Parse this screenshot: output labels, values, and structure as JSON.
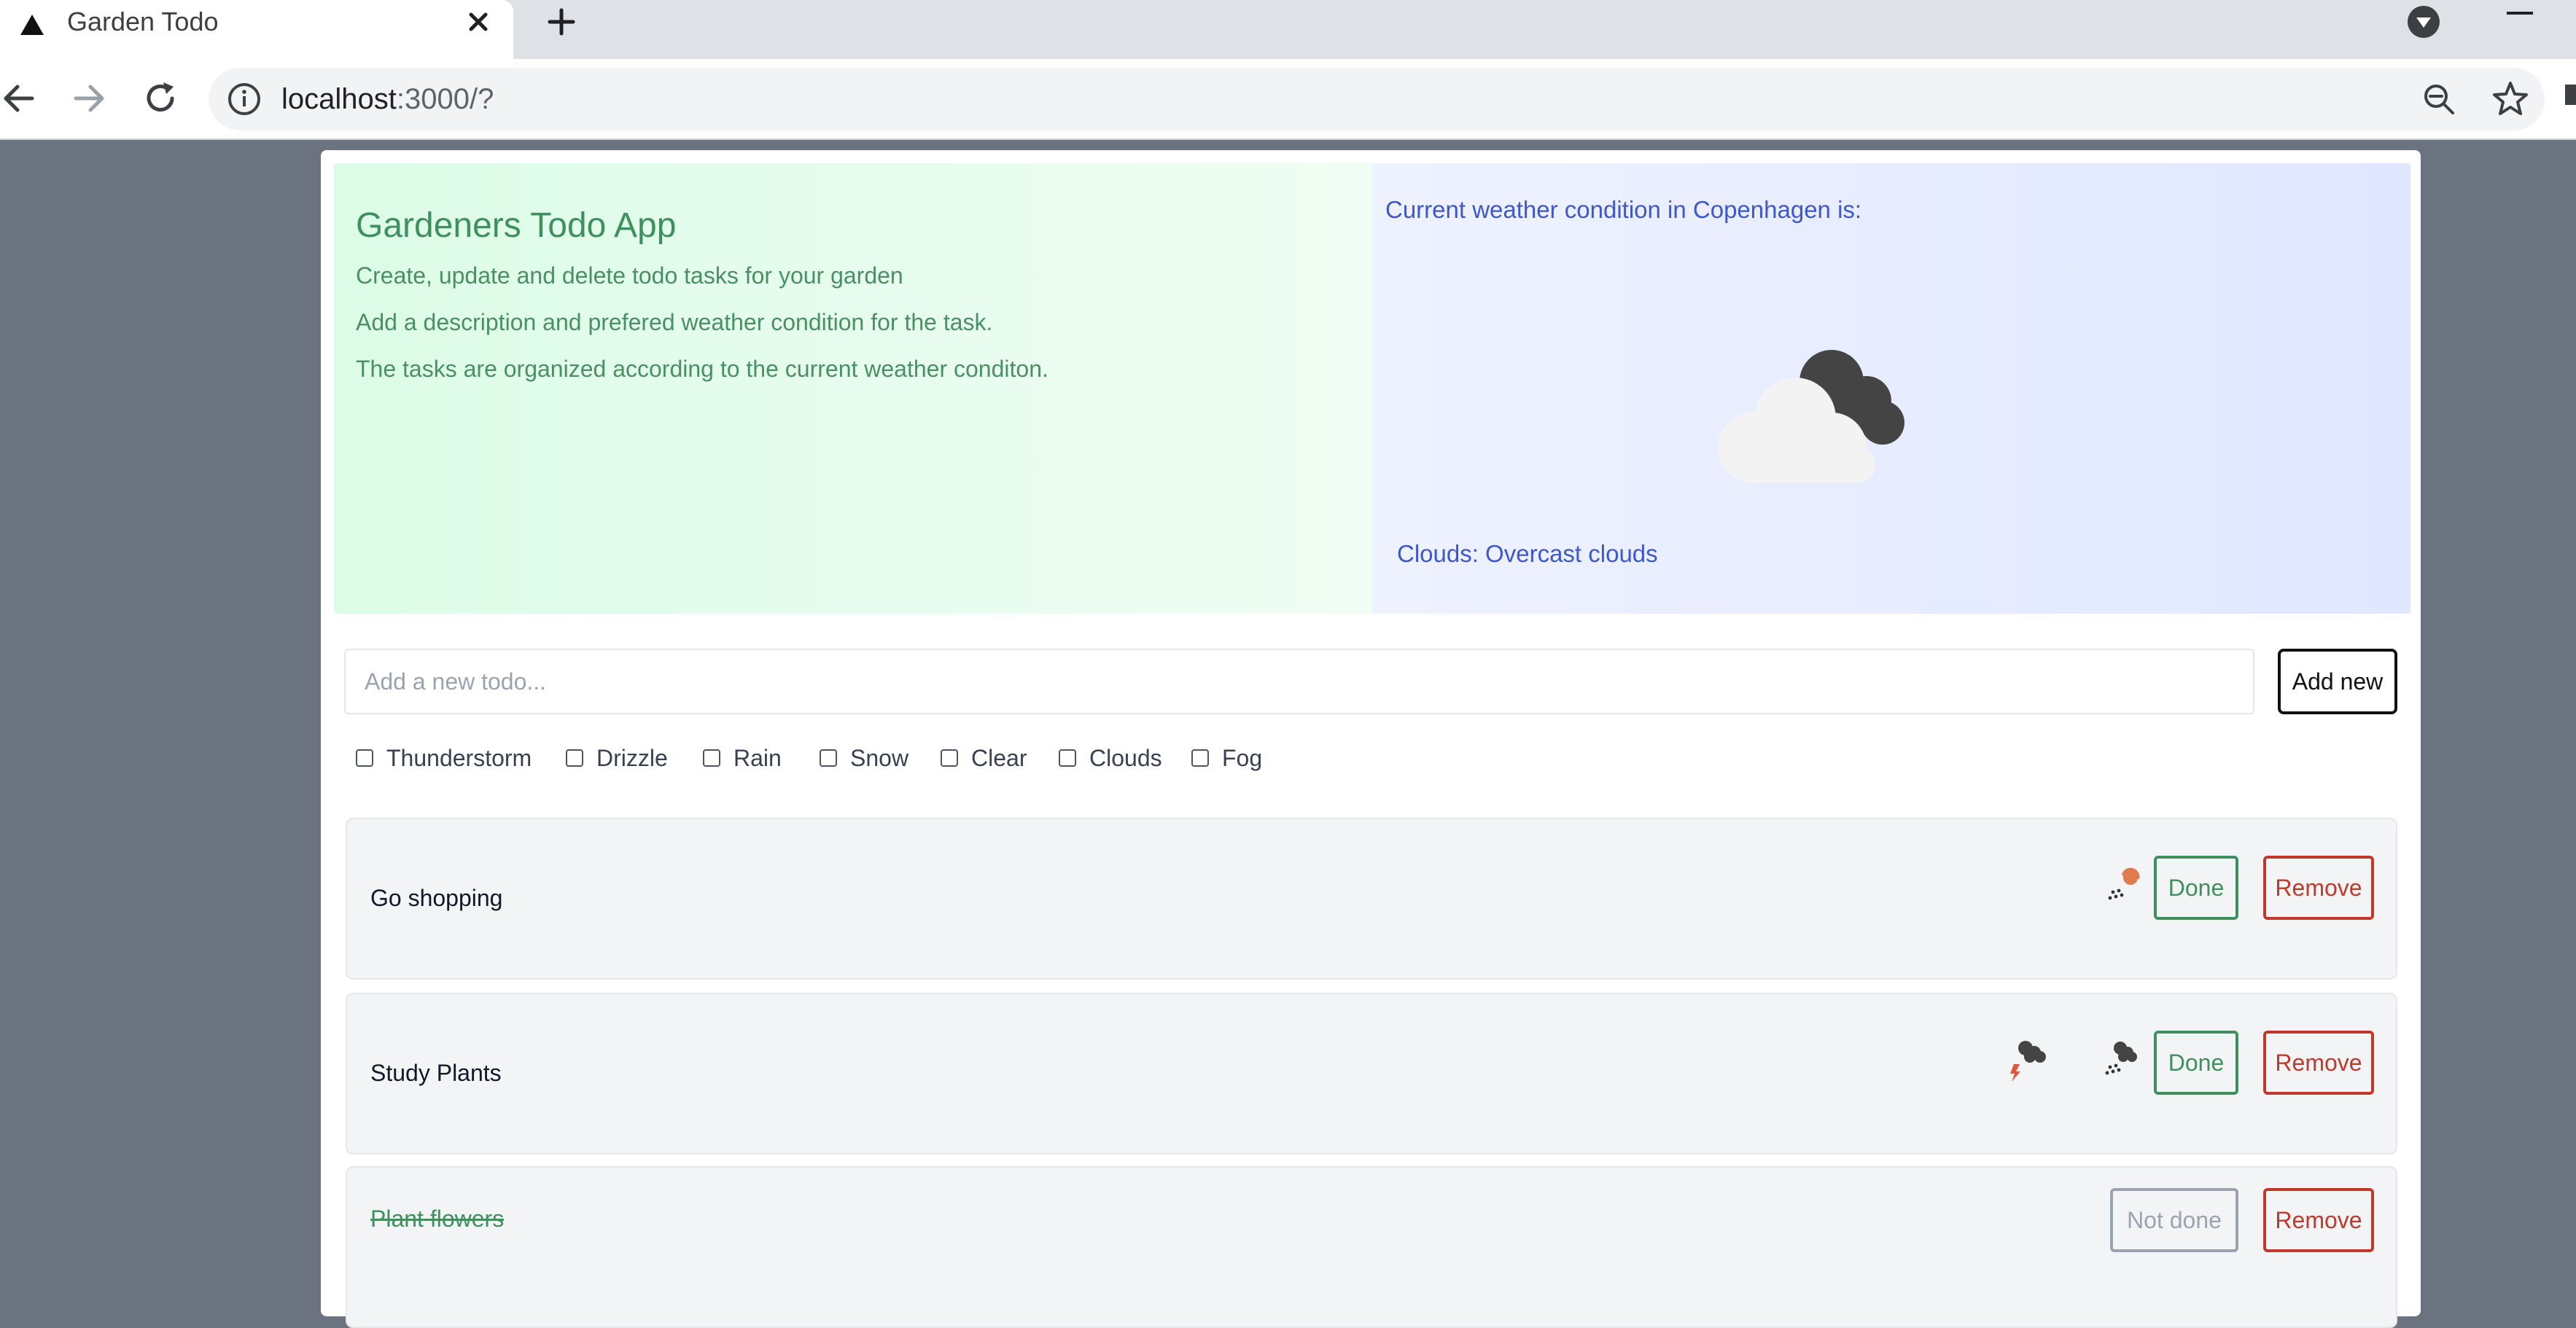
{
  "browser": {
    "tab_title": "Garden Todo",
    "url_host": "localhost",
    "url_rest": ":3000/?"
  },
  "hero": {
    "title": "Gardeners Todo App",
    "lines": [
      "Create, update and delete todo tasks for your garden",
      "Add a description and prefered weather condition for the task.",
      "The tasks are organized according to the current weather conditon."
    ]
  },
  "weather": {
    "heading": "Current weather condition in Copenhagen is:",
    "description": "Clouds: Overcast clouds",
    "icon": "overcast-clouds-icon"
  },
  "form": {
    "placeholder": "Add a new todo...",
    "add_label": "Add new",
    "conditions": [
      "Thunderstorm",
      "Drizzle",
      "Rain",
      "Snow",
      "Clear",
      "Clouds",
      "Fog"
    ]
  },
  "todos": [
    {
      "title": "Go shopping",
      "done": false,
      "action_label": "Done",
      "remove_label": "Remove",
      "weather_icons": [
        "drizzle-sun-icon"
      ]
    },
    {
      "title": "Study Plants",
      "done": false,
      "action_label": "Done",
      "remove_label": "Remove",
      "weather_icons": [
        "thunderstorm-icon",
        "drizzle-icon"
      ]
    },
    {
      "title": "Plant flowers",
      "done": true,
      "action_label": "Not done",
      "remove_label": "Remove",
      "weather_icons": []
    }
  ],
  "colors": {
    "green": "#3f8f5f",
    "blue": "#4057c9",
    "red": "#c0392b",
    "gray": "#9ca3af"
  }
}
